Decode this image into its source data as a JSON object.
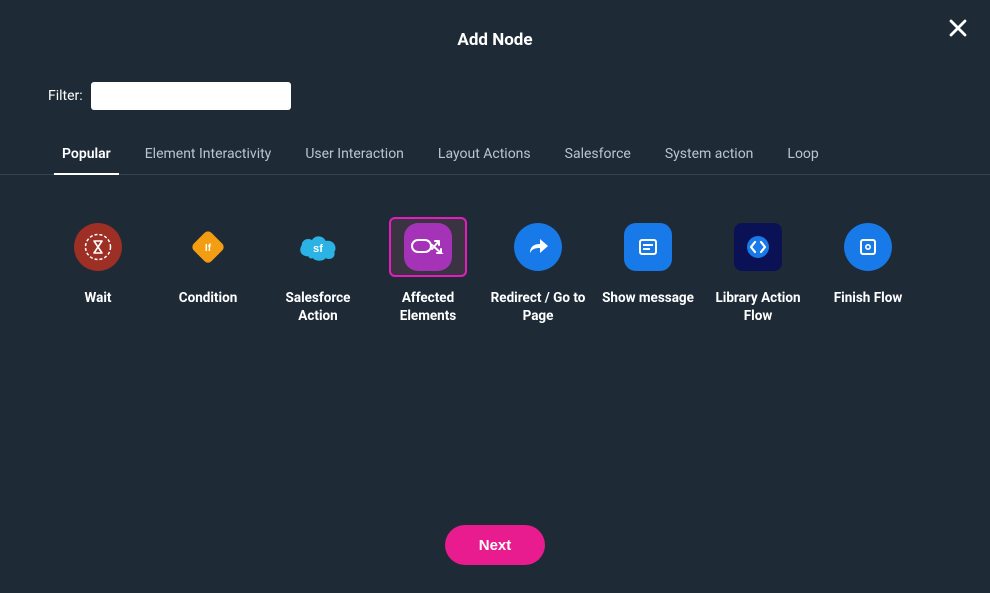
{
  "header": {
    "title": "Add Node"
  },
  "close_label": "Close",
  "filter": {
    "label": "Filter:",
    "value": ""
  },
  "tabs": [
    {
      "id": "popular",
      "label": "Popular",
      "active": true
    },
    {
      "id": "element-interactivity",
      "label": "Element Interactivity",
      "active": false
    },
    {
      "id": "user-interaction",
      "label": "User Interaction",
      "active": false
    },
    {
      "id": "layout-actions",
      "label": "Layout Actions",
      "active": false
    },
    {
      "id": "salesforce",
      "label": "Salesforce",
      "active": false
    },
    {
      "id": "system-action",
      "label": "System action",
      "active": false
    },
    {
      "id": "loop",
      "label": "Loop",
      "active": false
    }
  ],
  "nodes": [
    {
      "id": "wait",
      "label": "Wait",
      "icon": "hourglass-icon",
      "selected": false
    },
    {
      "id": "condition",
      "label": "Condition",
      "icon": "diamond-if-icon",
      "selected": false
    },
    {
      "id": "salesforce-action",
      "label": "Salesforce Action",
      "icon": "cloud-sf-icon",
      "selected": false
    },
    {
      "id": "affected-elements",
      "label": "Affected Elements",
      "icon": "affected-elements-icon",
      "selected": true
    },
    {
      "id": "redirect",
      "label": "Redirect / Go to Page",
      "icon": "share-arrow-icon",
      "selected": false
    },
    {
      "id": "show-message",
      "label": "Show message",
      "icon": "message-lines-icon",
      "selected": false
    },
    {
      "id": "library-action-flow",
      "label": "Library Action Flow",
      "icon": "code-brackets-icon",
      "selected": false
    },
    {
      "id": "finish-flow",
      "label": "Finish Flow",
      "icon": "stop-square-icon",
      "selected": false
    }
  ],
  "footer": {
    "next": "Next"
  },
  "colors": {
    "background": "#1e2b36",
    "accent": "#e81c8f",
    "selection": "#e61cbf",
    "blue": "#1879e8",
    "orange": "#f29d12",
    "purple": "#a533b7",
    "brown": "#9d2f25",
    "navy": "#0a1255",
    "skyblue": "#2bb3e6"
  }
}
